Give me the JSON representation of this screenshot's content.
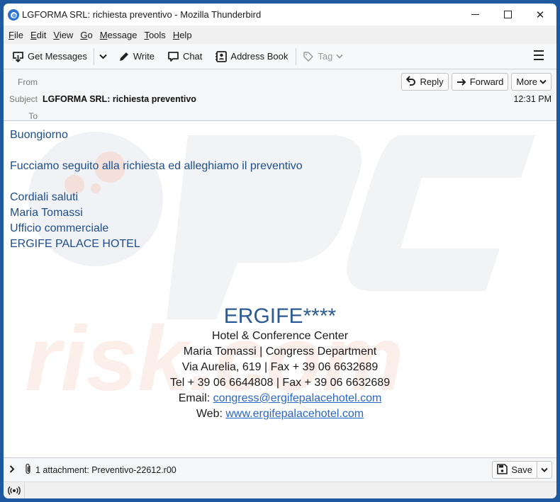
{
  "window": {
    "title": "LGFORMA SRL: richiesta preventivo - Mozilla Thunderbird",
    "controls": {
      "minimize": "minimize",
      "maximize": "maximize",
      "close": "✕"
    }
  },
  "menubar": {
    "items": [
      {
        "label": "File",
        "accel": "F",
        "rest": "ile"
      },
      {
        "label": "Edit",
        "accel": "E",
        "rest": "dit"
      },
      {
        "label": "View",
        "accel": "V",
        "rest": "iew"
      },
      {
        "label": "Go",
        "accel": "G",
        "rest": "o"
      },
      {
        "label": "Message",
        "accel": "M",
        "rest": "essage"
      },
      {
        "label": "Tools",
        "accel": "T",
        "rest": "ools"
      },
      {
        "label": "Help",
        "accel": "H",
        "rest": "elp"
      }
    ]
  },
  "toolbar": {
    "get_messages": "Get Messages",
    "write": "Write",
    "chat": "Chat",
    "address_book": "Address Book",
    "tag": "Tag"
  },
  "header": {
    "from_label": "From",
    "subject_label": "Subject",
    "to_label": "To",
    "subject": "LGFORMA SRL: richiesta preventivo",
    "time": "12:31 PM",
    "reply": "Reply",
    "forward": "Forward",
    "more": "More"
  },
  "body": {
    "greeting": "Buongiorno",
    "line1": "Fucciamo seguito alla richiesta ed alleghiamo il preventivo",
    "closing": "Cordiali saluti",
    "name": "Maria Tomassi",
    "department": "Ufficio commerciale",
    "company": "ERGIFE PALACE HOTEL"
  },
  "signature": {
    "title": "ERGIFE****",
    "subtitle": "Hotel & Conference Center",
    "person": "Maria Tomassi | Congress Department",
    "address": "Via Aurelia, 619 | Fax + 39 06 6632689",
    "phones": "Tel + 39 06 6644808 | Fax + 39 06 6632689",
    "email_label": "Email: ",
    "email": "congress@ergifepalacehotel.com",
    "web_label": "Web: ",
    "web": "www.ergifepalacehotel.com"
  },
  "attachment": {
    "summary": "1 attachment: Preventivo-22612.r00",
    "save": "Save"
  },
  "watermark": {
    "top": "PC",
    "bottom": "risk.com"
  },
  "colors": {
    "body_text": "#1f4e8c",
    "link": "#2a66c8",
    "frame": "#1f5aa0"
  }
}
